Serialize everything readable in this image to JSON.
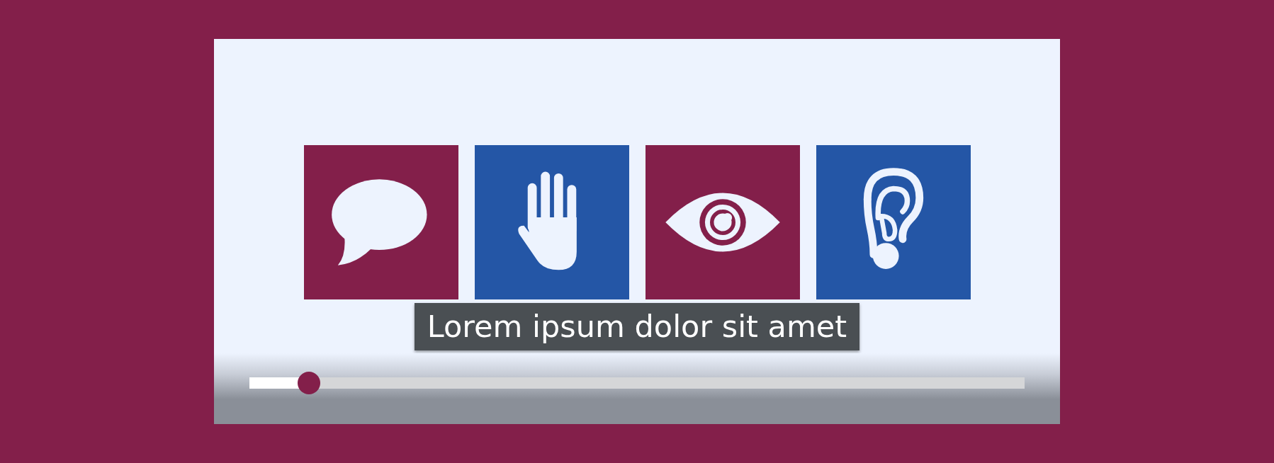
{
  "video": {
    "tiles": [
      {
        "kind": "speech",
        "color": "#831f4a"
      },
      {
        "kind": "hand",
        "color": "#2456a6"
      },
      {
        "kind": "eye",
        "color": "#831f4a"
      },
      {
        "kind": "ear",
        "color": "#2456a6"
      }
    ],
    "caption": "Lorem ipsum dolor sit amet",
    "progress": {
      "level": 0.077
    }
  }
}
